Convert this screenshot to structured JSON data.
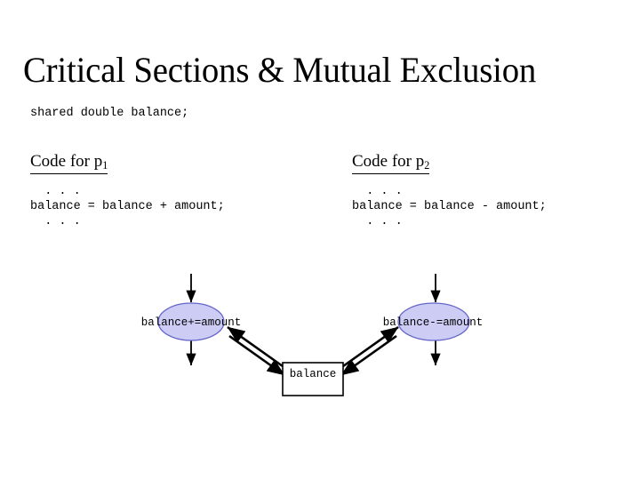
{
  "slide": {
    "title": "Critical Sections & Mutual Exclusion",
    "shared_declaration": "shared double balance;",
    "background_color": "#ffffff",
    "text_color": "#000000"
  },
  "columns": [
    {
      "heading_prefix": "Code for p",
      "heading_subscript": "1",
      "code": "  . . .\nbalance = balance + amount;\n  . . ."
    },
    {
      "heading_prefix": "Code for p",
      "heading_subscript": "2",
      "code": "  . . .\nbalance = balance - amount;\n  . . ."
    }
  ],
  "diagram": {
    "node_fill_color": "#ccccf5",
    "node_stroke_color": "#6666cc",
    "box_fill_color": "#ffffff",
    "box_stroke_color": "#000000",
    "arrow_color": "#000000",
    "nodes": [
      {
        "id": "op-p1",
        "label": "balance+=amount",
        "shape": "ellipse"
      },
      {
        "id": "op-p2",
        "label": "balance-=amount",
        "shape": "ellipse"
      },
      {
        "id": "shared-var",
        "label": "balance",
        "shape": "rectangle"
      }
    ]
  }
}
